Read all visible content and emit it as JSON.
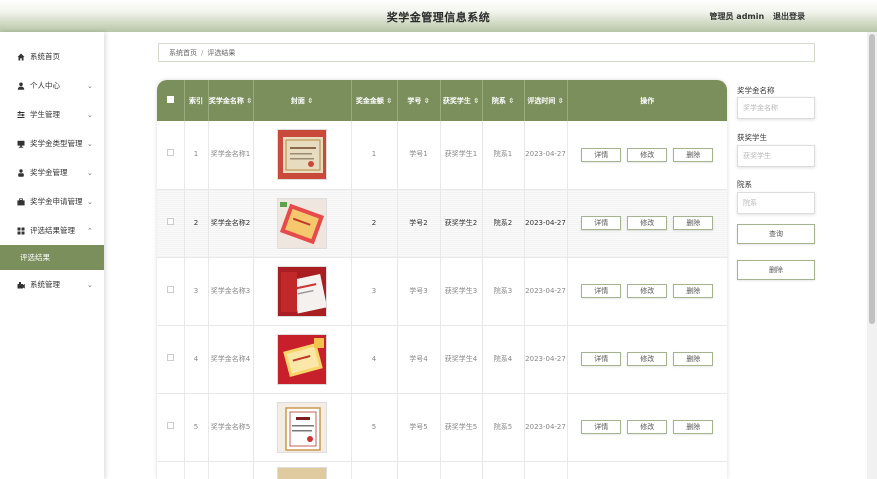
{
  "header": {
    "title": "奖学金管理信息系统",
    "user": "管理员 admin",
    "logout": "退出登录"
  },
  "sidebar": {
    "items": [
      {
        "label": "系统首页",
        "icon": "home-icon",
        "chevron": ""
      },
      {
        "label": "个人中心",
        "icon": "user-icon",
        "chevron": "⌄"
      },
      {
        "label": "学生管理",
        "icon": "sliders-icon",
        "chevron": "⌄"
      },
      {
        "label": "奖学金类型管理",
        "icon": "monitor-icon",
        "chevron": "⌄"
      },
      {
        "label": "奖学金管理",
        "icon": "person-icon",
        "chevron": "⌄"
      },
      {
        "label": "奖学金申请管理",
        "icon": "briefcase-icon",
        "chevron": "⌄"
      },
      {
        "label": "评选结果管理",
        "icon": "grid-icon",
        "chevron": "⌃"
      },
      {
        "label": "评选结果",
        "icon": "",
        "chevron": ""
      },
      {
        "label": "系统管理",
        "icon": "gear-icon",
        "chevron": "⌄"
      }
    ]
  },
  "breadcrumb": {
    "home": "系统首页",
    "sep": "/",
    "current": "评选结果"
  },
  "table": {
    "headers": [
      "",
      "索引",
      "奖学金名称 ⇳",
      "封面 ⇳",
      "奖金金额 ⇳",
      "学号 ⇳",
      "获奖学生 ⇳",
      "院系 ⇳",
      "评选时间 ⇳",
      "操作"
    ],
    "rows": [
      {
        "index": "1",
        "name": "奖学金名称1",
        "amount": "1",
        "student_no": "学号1",
        "student": "获奖学生1",
        "dept": "院系1",
        "date": "2023-04-27"
      },
      {
        "index": "2",
        "name": "奖学金名称2",
        "amount": "2",
        "student_no": "学号2",
        "student": "获奖学生2",
        "dept": "院系2",
        "date": "2023-04-27"
      },
      {
        "index": "3",
        "name": "奖学金名称3",
        "amount": "3",
        "student_no": "学号3",
        "student": "获奖学生3",
        "dept": "院系3",
        "date": "2023-04-27"
      },
      {
        "index": "4",
        "name": "奖学金名称4",
        "amount": "4",
        "student_no": "学号4",
        "student": "获奖学生4",
        "dept": "院系4",
        "date": "2023-04-27"
      },
      {
        "index": "5",
        "name": "奖学金名称5",
        "amount": "5",
        "student_no": "学号5",
        "student": "获奖学生5",
        "dept": "院系5",
        "date": "2023-04-27"
      }
    ],
    "actions": {
      "detail": "详情",
      "edit": "修改",
      "delete": "删除"
    }
  },
  "filters": {
    "name_label": "奖学金名称",
    "name_placeholder": "奖学金名称",
    "student_label": "获奖学生",
    "student_placeholder": "获奖学生",
    "dept_label": "院系",
    "dept_placeholder": "院系",
    "search_button": "查询",
    "delete_button": "删除"
  },
  "colors": {
    "accent": "#7b8f5d",
    "header_gradient_end": "#b7c5a6"
  }
}
